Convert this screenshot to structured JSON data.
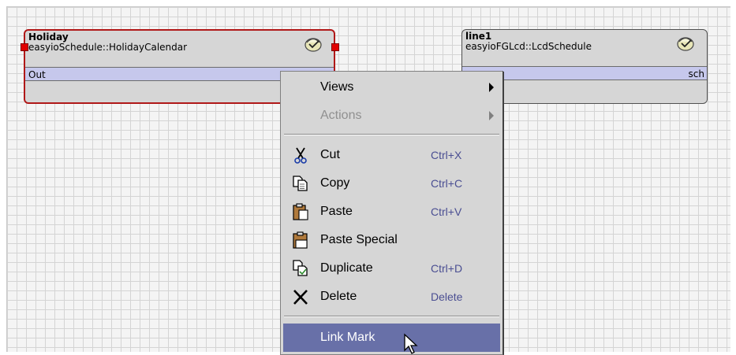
{
  "blocks": {
    "holiday": {
      "name": "Holiday",
      "type": "easyioSchedule::HolidayCalendar",
      "slot": "Out",
      "selected": true
    },
    "line1": {
      "name": "line1",
      "type": "easyioFGLcd::LcdSchedule",
      "slot": "sch",
      "selected": false
    }
  },
  "context_menu": {
    "items": [
      {
        "id": "views",
        "label": "Views",
        "submenu": true,
        "enabled": true
      },
      {
        "id": "actions",
        "label": "Actions",
        "submenu": true,
        "enabled": false
      },
      {
        "id": "cut",
        "label": "Cut",
        "shortcut": "Ctrl+X",
        "icon": "scissors-icon"
      },
      {
        "id": "copy",
        "label": "Copy",
        "shortcut": "Ctrl+C",
        "icon": "copy-icon"
      },
      {
        "id": "paste",
        "label": "Paste",
        "shortcut": "Ctrl+V",
        "icon": "clipboard-icon"
      },
      {
        "id": "paste_special",
        "label": "Paste Special",
        "icon": "clipboard-icon"
      },
      {
        "id": "duplicate",
        "label": "Duplicate",
        "shortcut": "Ctrl+D",
        "icon": "duplicate-icon"
      },
      {
        "id": "delete",
        "label": "Delete",
        "shortcut": "Delete",
        "icon": "x-delete-icon"
      },
      {
        "id": "link_mark",
        "label": "Link Mark",
        "highlighted": true
      }
    ]
  },
  "colors": {
    "selection": "#b01818",
    "handle": "#e10000",
    "slot": "#c6c8ec",
    "menu_highlight": "#6870a8",
    "shortcut_text": "#4a4e92"
  }
}
